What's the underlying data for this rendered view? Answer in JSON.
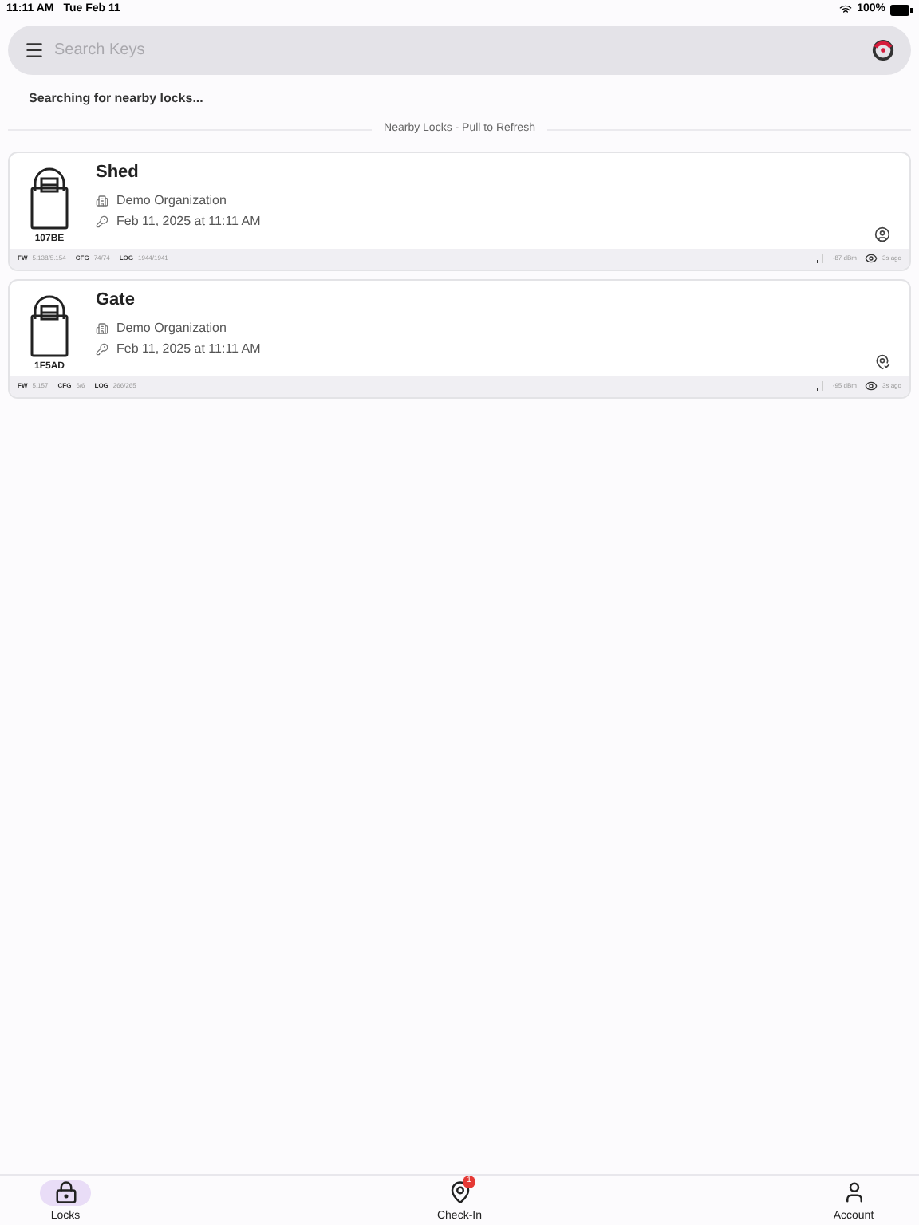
{
  "status_bar": {
    "time": "11:11 AM",
    "date": "Tue Feb 11",
    "battery": "100%"
  },
  "search": {
    "placeholder": "Search Keys"
  },
  "scan_status": "Searching for nearby locks...",
  "section_header": "Nearby Locks - Pull to Refresh",
  "locks": [
    {
      "name": "Shed",
      "lock_id": "107BE",
      "organization": "Demo Organization",
      "last_access": "Feb 11, 2025 at 11:11 AM",
      "kind": "person",
      "fw_label": "FW",
      "fw": "5.138/5.154",
      "cfg_label": "CFG",
      "cfg": "74/74",
      "log_label": "LOG",
      "log": "1944/1941",
      "rssi": "-87 dBm",
      "seen": "3s ago"
    },
    {
      "name": "Gate",
      "lock_id": "1F5AD",
      "organization": "Demo Organization",
      "last_access": "Feb 11, 2025 at 11:11 AM",
      "kind": "location",
      "fw_label": "FW",
      "fw": "5.157",
      "cfg_label": "CFG",
      "cfg": "6/6",
      "log_label": "LOG",
      "log": "266/265",
      "rssi": "-95 dBm",
      "seen": "3s ago"
    }
  ],
  "tabs": [
    {
      "label": "Locks",
      "kind": "lock",
      "selected": true
    },
    {
      "label": "Check-In",
      "kind": "checkin",
      "selected": false,
      "badge": "1"
    },
    {
      "label": "Account",
      "kind": "account",
      "selected": false
    }
  ]
}
